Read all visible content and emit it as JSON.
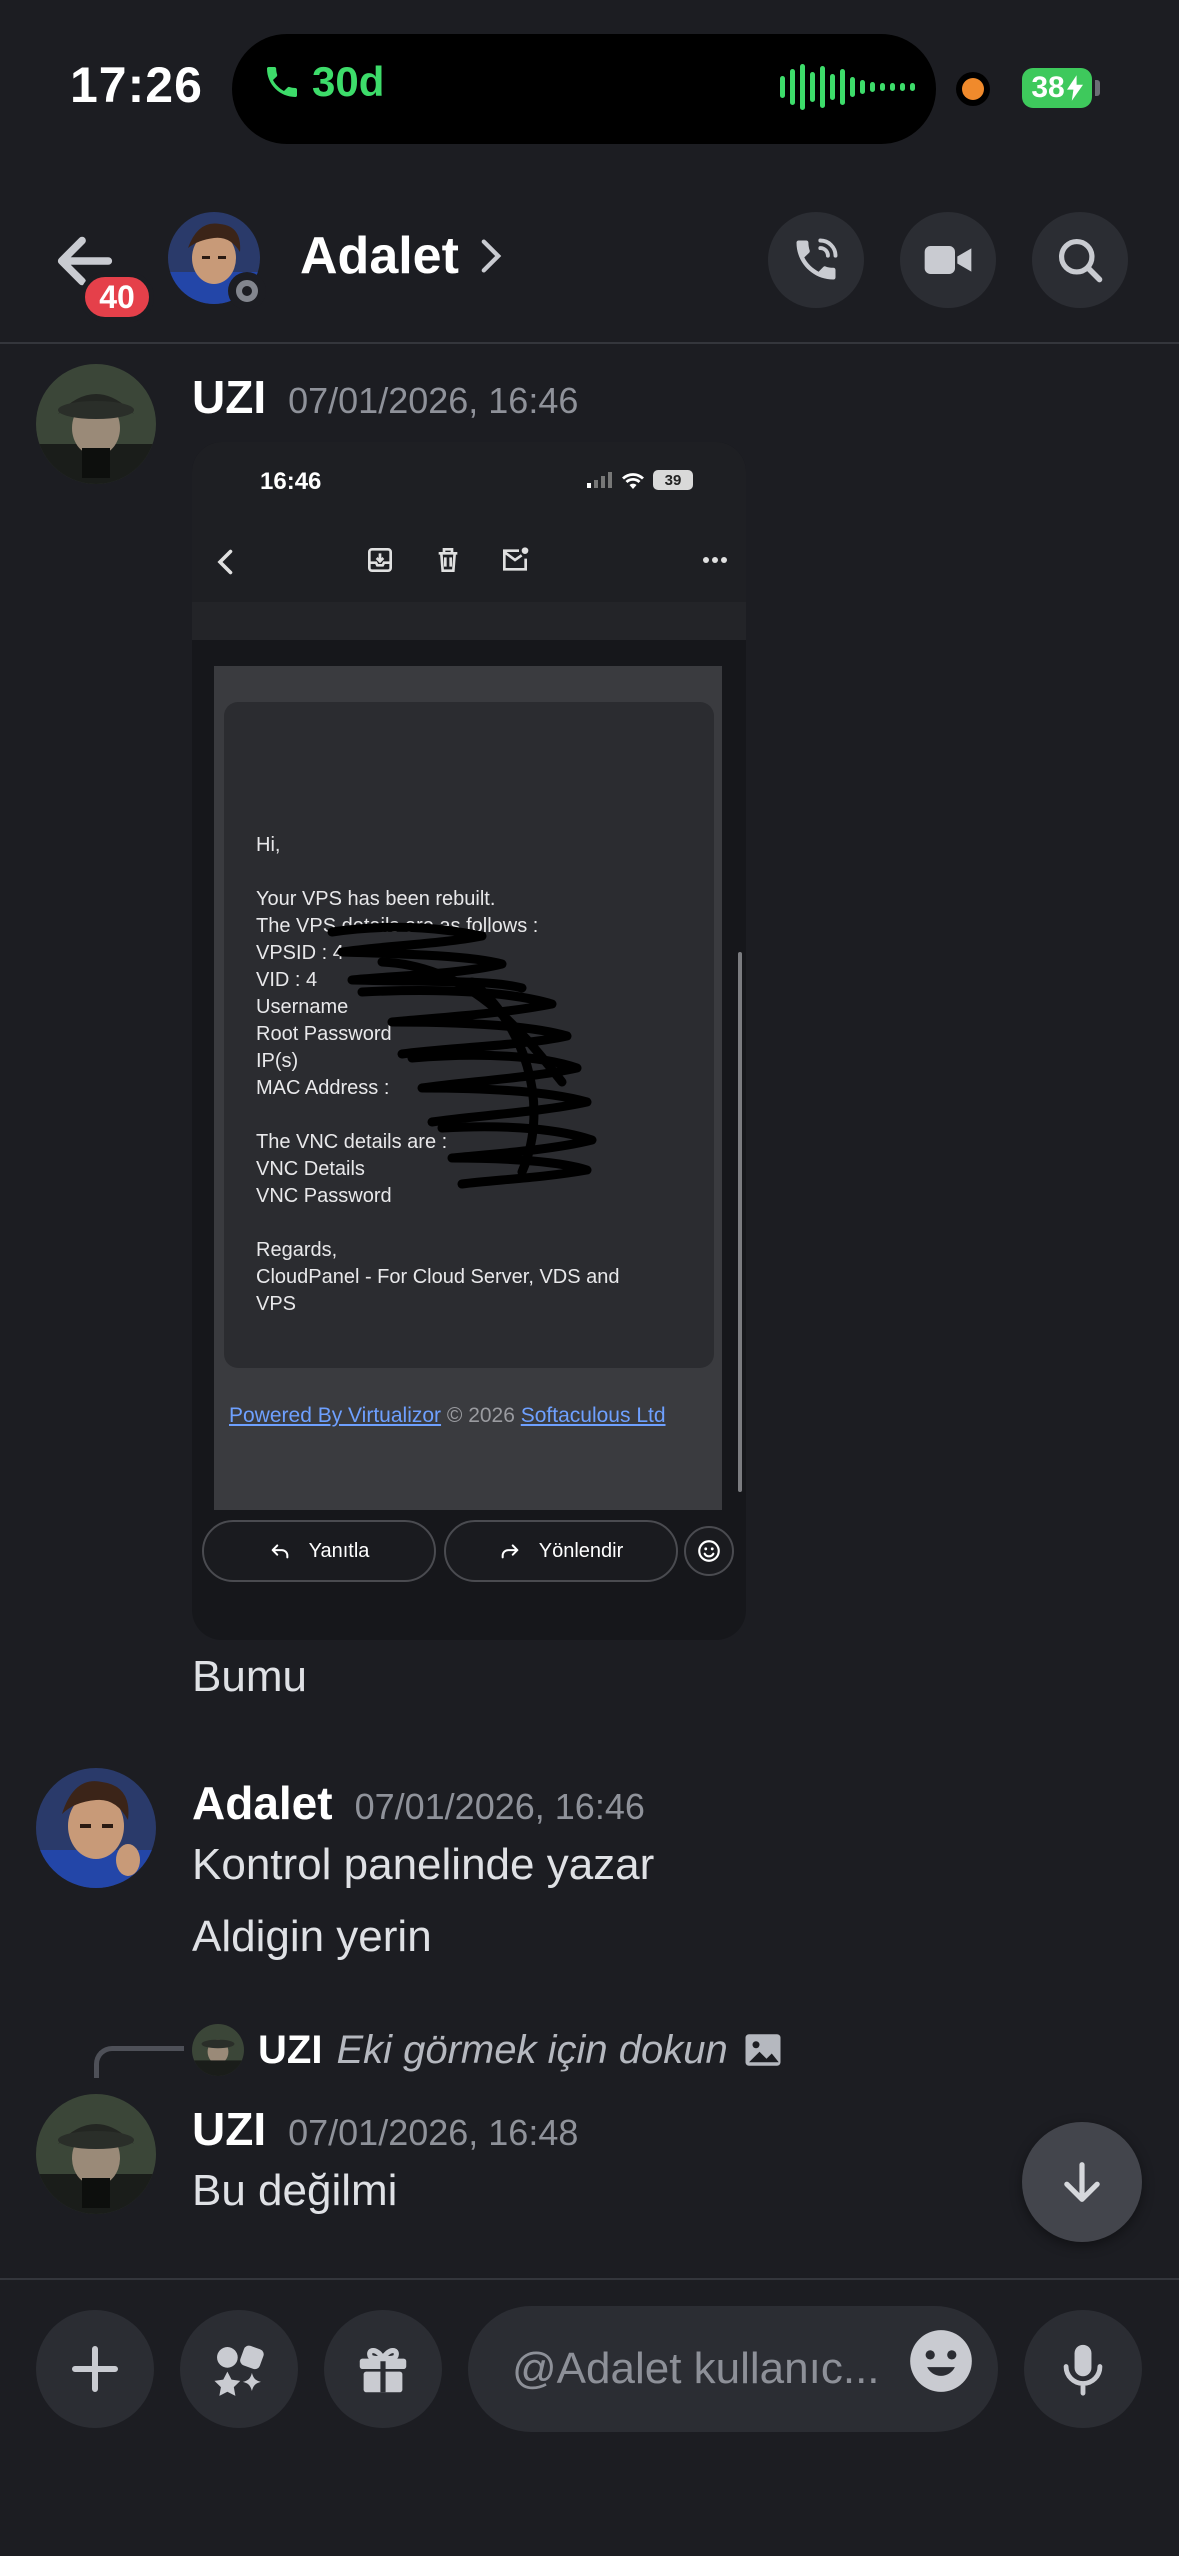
{
  "status_bar": {
    "time": "17:26",
    "call_duration": "30d",
    "battery": "38"
  },
  "header": {
    "unread_badge": "40",
    "contact_name": "Adalet"
  },
  "messages": [
    {
      "author": "UZI",
      "timestamp": "07/01/2026, 16:46",
      "attachment": {
        "phone_time": "16:46",
        "phone_battery": "39",
        "email_lines": [
          "Hi,",
          "",
          "Your VPS has been rebuilt.",
          "The VPS details are as follows :",
          "VPSID : 4",
          "VID : 4",
          "Username",
          "Root Password",
          "IP(s)",
          "MAC Address :",
          "",
          "The VNC details are :",
          "VNC Details",
          "VNC Password",
          "",
          "Regards,",
          "CloudPanel - For Cloud Server, VDS and",
          "VPS"
        ],
        "footer_link_1": "Powered By Virtualizor",
        "footer_copy": " © 2026 ",
        "footer_link_2": "Softaculous Ltd",
        "reply_label": "Yanıtla",
        "forward_label": "Yönlendir"
      },
      "text": "Bumu"
    },
    {
      "author": "Adalet",
      "timestamp": "07/01/2026, 16:46",
      "lines": [
        "Kontrol panelinde yazar",
        "Aldigin yerin"
      ]
    },
    {
      "reply_to_author": "UZI",
      "reply_to_text": "Eki görmek için dokun",
      "author": "UZI",
      "timestamp": "07/01/2026, 16:48",
      "text": "Bu değilmi"
    }
  ],
  "composer": {
    "placeholder": "@Adalet kullanıc..."
  },
  "colors": {
    "background": "#1c1d22",
    "call_green": "#3ddc6a",
    "badge_red": "#e5404a",
    "link_blue": "#6ea0ff"
  }
}
